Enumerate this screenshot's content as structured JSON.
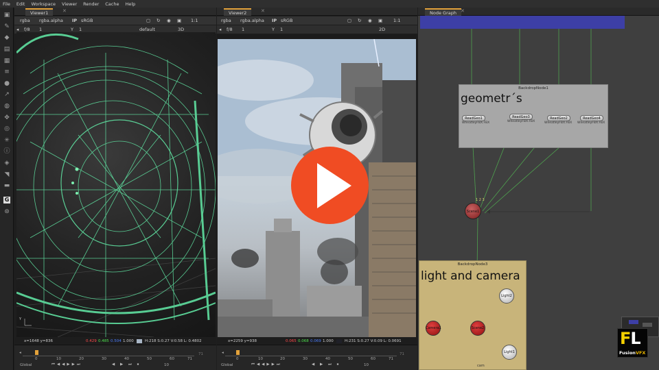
{
  "menu": [
    "File",
    "Edit",
    "Workspace",
    "Viewer",
    "Render",
    "Cache",
    "Help"
  ],
  "toolbar_icons": [
    "pointer-icon",
    "brush-icon",
    "shapes-icon",
    "layers-icon",
    "grid-icon",
    "menu-icon",
    "circle-icon",
    "graph-icon",
    "globe-icon",
    "transform-icon",
    "lens-icon",
    "particles-icon",
    "info-icon",
    "shape3d-icon",
    "tag-icon",
    "toolsets-icon",
    "gizmo-icon",
    "other-icon"
  ],
  "viewer1": {
    "tab": "Viewer1",
    "channels": "rgba",
    "alpha": "rgba.alpha",
    "ip": "IP",
    "colorspace": "sRGB",
    "zoom": "1:1",
    "fstop": "f/8",
    "gain": "1",
    "y_label": "Y",
    "y_value": "1",
    "lut": "default",
    "mode": "3D",
    "status": {
      "coords": "x=1648 y=836",
      "r": "0.429",
      "g": "0.485",
      "b": "0.504",
      "a": "1.000",
      "hsvl": "H:218 S:0.27 V:0.58  L: 0.4802"
    },
    "timeline": {
      "ticks": [
        "0",
        "10",
        "20",
        "30",
        "40",
        "50",
        "60",
        "71"
      ],
      "end": "71",
      "global": "Global",
      "step": "10"
    }
  },
  "viewer2": {
    "tab": "Viewer2",
    "channels": "rgba",
    "alpha": "rgba.alpha",
    "ip": "IP",
    "colorspace": "sRGB",
    "zoom": "1:1",
    "fstop": "f/8",
    "gain": "1",
    "y_label": "Y",
    "y_value": "1",
    "mode": "2D",
    "status": {
      "coords": "x=2259 y=938",
      "r": "0.065",
      "g": "0.068",
      "b": "0.069",
      "a": "1.000",
      "hsvl": "H:231 S:0.27 V:0.09  L: 0.0691"
    },
    "timeline": {
      "ticks": [
        "0",
        "10",
        "20",
        "30",
        "40",
        "50",
        "60",
        "71"
      ],
      "end": "71",
      "global": "Global",
      "step": "10"
    }
  },
  "node_graph": {
    "tab": "Node Graph",
    "backdrop1": {
      "title": "BackdropNode1",
      "label": "geometr´s",
      "nodes": [
        {
          "name": "ReadGeo1",
          "file": "WheatleyFBX.FBX"
        },
        {
          "name": "ReadGeo3",
          "file": "WheatleyFBX.FBX"
        },
        {
          "name": "ReadGeo2",
          "file": "WheatleyFBX.FBX"
        },
        {
          "name": "ReadGeo4",
          "file": "WheatleyFBX.FBX"
        }
      ]
    },
    "scene_node": {
      "label": "Scene1",
      "inputs": "1 2 3"
    },
    "backdrop3": {
      "title": "BackdropNode3",
      "label": "light and camera",
      "lights": [
        "Light2",
        "Light1"
      ],
      "cameras": [
        "Camera1",
        "Scene2"
      ],
      "edge_label": "cam"
    }
  },
  "logo": {
    "letters_f": "F",
    "letters_l": "L",
    "fusion": "Fusion",
    "vfx": "VFX"
  },
  "colors": {
    "accent_tab": "#e3a23b",
    "play_button": "#f04c23",
    "backdrop1": "#a7a7a7",
    "backdrop3": "#c8b47a",
    "node_red": "#a82020",
    "wireframe": "#5fe0a0"
  }
}
